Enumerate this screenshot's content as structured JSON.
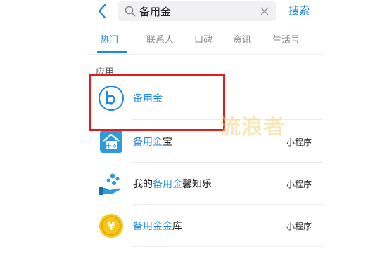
{
  "search": {
    "query": "备用金",
    "button_label": "搜索"
  },
  "tabs": [
    {
      "label": "热门",
      "active": true
    },
    {
      "label": "联系人",
      "active": false
    },
    {
      "label": "口碑",
      "active": false
    },
    {
      "label": "资讯",
      "active": false
    },
    {
      "label": "生活号",
      "active": false
    }
  ],
  "section": {
    "title": "应用"
  },
  "results": [
    {
      "icon": "beiyongjin-logo-icon",
      "highlight": "备用金",
      "prefix": "",
      "suffix": "",
      "tag": ""
    },
    {
      "icon": "house-calculator-icon",
      "highlight": "备用金",
      "prefix": "",
      "suffix": "宝",
      "tag": "小程序"
    },
    {
      "icon": "coins-hand-icon",
      "highlight": "备用金",
      "prefix": "我的",
      "suffix": "馨知乐",
      "tag": "小程序"
    },
    {
      "icon": "yuan-coin-icon",
      "highlight": "备用金金",
      "prefix": "",
      "suffix": "库",
      "tag": "小程序"
    }
  ],
  "watermark": "流浪者",
  "colors": {
    "accent": "#1e88e5",
    "highlight_box": "#d9201e",
    "watermark": "#eed680"
  }
}
